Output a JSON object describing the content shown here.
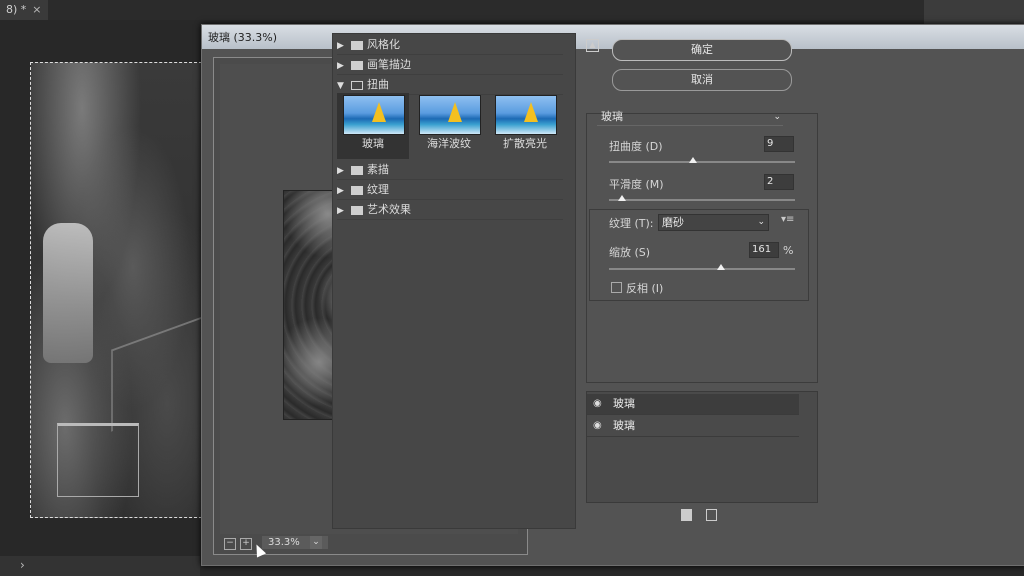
{
  "app": {
    "doc_tab": "8) *",
    "doc_tab_close": "×"
  },
  "dialog": {
    "title": "玻璃 (33.3%)",
    "zoom": {
      "value": "33.3%",
      "zoom_out_symbol": "−",
      "zoom_in_symbol": "+"
    },
    "categories": [
      {
        "label": "风格化",
        "expanded": false
      },
      {
        "label": "画笔描边",
        "expanded": false
      },
      {
        "label": "扭曲",
        "expanded": true
      },
      {
        "label": "素描",
        "expanded": false
      },
      {
        "label": "纹理",
        "expanded": false
      },
      {
        "label": "艺术效果",
        "expanded": false
      }
    ],
    "distort_filters": [
      {
        "label": "玻璃",
        "selected": true
      },
      {
        "label": "海洋波纹",
        "selected": false
      },
      {
        "label": "扩散亮光",
        "selected": false
      }
    ],
    "buttons": {
      "ok": "确定",
      "cancel": "取消"
    },
    "settings": {
      "filter_name": "玻璃",
      "distortion": {
        "label": "扭曲度 (D)",
        "value": "9",
        "level": 0.45
      },
      "smoothness": {
        "label": "平滑度 (M)",
        "value": "2",
        "level": 0.07
      },
      "texture": {
        "label": "纹理 (T):",
        "value": "磨砂"
      },
      "scaling": {
        "label": "缩放 (S)",
        "value": "161",
        "unit": "%",
        "level": 0.6
      },
      "invert": {
        "label": "反相 (I)",
        "checked": false
      }
    },
    "layers": [
      {
        "label": "玻璃",
        "visible": true,
        "active": true
      },
      {
        "label": "玻璃",
        "visible": true,
        "active": false
      }
    ]
  },
  "colors": {
    "dialog_bg": "#535353",
    "titlebar": "#c6ccd3",
    "panel": "#474747"
  }
}
